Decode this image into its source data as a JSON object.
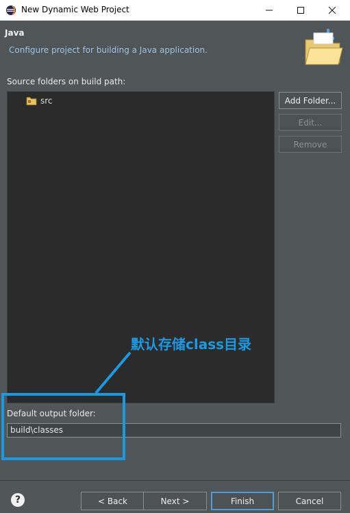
{
  "window": {
    "title": "New Dynamic Web Project",
    "minimize": "—",
    "maximize": "☐",
    "close": "✕"
  },
  "header": {
    "title": "Java",
    "description": "Configure project for building a Java application."
  },
  "source": {
    "label": "Source folders on build path:",
    "items": [
      {
        "name": "src"
      }
    ]
  },
  "side_buttons": {
    "add_folder": "Add Folder...",
    "edit": "Edit...",
    "remove": "Remove"
  },
  "output": {
    "label": "Default output folder:",
    "value": "build\\classes"
  },
  "annotation": {
    "text": "默认存储class目录",
    "color": "#1b9ae4"
  },
  "footer": {
    "help": "?",
    "back": "< Back",
    "next": "Next >",
    "finish": "Finish",
    "cancel": "Cancel"
  }
}
